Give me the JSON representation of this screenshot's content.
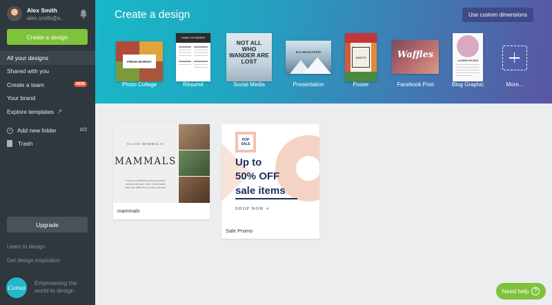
{
  "sidebar": {
    "user_name": "Alex Smith",
    "user_email": "alex.smith@e...",
    "create_label": "Create a design",
    "nav": [
      {
        "label": "All your designs",
        "active": true
      },
      {
        "label": "Shared with you"
      },
      {
        "label": "Create a team",
        "badge": "NEW"
      },
      {
        "label": "Your brand"
      },
      {
        "label": "Explore templates"
      }
    ],
    "add_folder_label": "Add new folder",
    "folder_count": "0/2",
    "trash_label": "Trash",
    "upgrade_label": "Upgrade",
    "learn_label": "Learn to design",
    "inspiration_label": "Get design inspiration",
    "logo_text": "Canva",
    "tagline": "Empowering the world to design"
  },
  "header": {
    "title": "Create a design",
    "custom_dims_label": "Use custom dimensions",
    "templates": [
      {
        "label": "Photo Collage",
        "thumb_text": "FRESH MARKET",
        "icon": "collage-thumbnail"
      },
      {
        "label": "Résumé",
        "thumb_text": "DANIEL SCHNEIDER",
        "icon": "resume-thumbnail"
      },
      {
        "label": "Social Media",
        "thumb_text": "NOT ALL WHO WANDER ARE LOST",
        "icon": "social-thumbnail"
      },
      {
        "label": "Presentation",
        "thumb_text": "KILIMANJARO",
        "icon": "presentation-thumbnail"
      },
      {
        "label": "Poster",
        "thumb_text": "JUICY'S",
        "icon": "poster-thumbnail"
      },
      {
        "label": "Facebook Post",
        "thumb_text": "Waffles",
        "icon": "facebook-thumbnail"
      },
      {
        "label": "Blog Graphic",
        "thumb_text": "LAUREN HOLDEN",
        "icon": "blog-thumbnail"
      },
      {
        "label": "More...",
        "icon": "plus-icon"
      }
    ]
  },
  "designs": [
    {
      "caption": "mammals",
      "subtitle": "CLASS MAMMALIA",
      "title": "MAMMALS",
      "body": "Lorem sed different mammal species animals with each other. What makes mammals different from other animals?"
    },
    {
      "caption": "Sale Promo",
      "badge_line1": "POP",
      "badge_line2": "SALE",
      "line1": "Up to",
      "line2": "50% OFF",
      "line3": "sale items",
      "cta": "SHOP NOW >"
    }
  ],
  "help_label": "Need help",
  "colors": {
    "sidebar_bg": "#2f373f",
    "accent_green": "#7fc33c",
    "header_gradient_start": "#19b8c8",
    "header_gradient_end": "#5a55a3",
    "sale_navy": "#1f2d5c",
    "sale_peach": "#f3c2ae"
  }
}
